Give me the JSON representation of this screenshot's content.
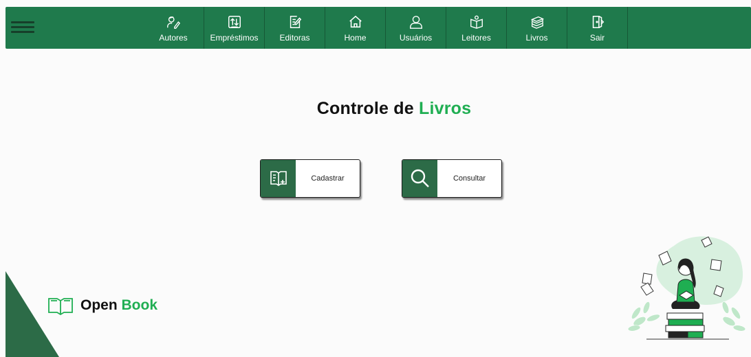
{
  "nav": {
    "menu_icon": "hamburger-icon",
    "items": [
      {
        "label": "Autores",
        "icon": "authors-icon"
      },
      {
        "label": "Empréstimos",
        "icon": "swap-icon"
      },
      {
        "label": "Editoras",
        "icon": "edit-document-icon"
      },
      {
        "label": "Home",
        "icon": "home-icon"
      },
      {
        "label": "Usuários",
        "icon": "user-icon"
      },
      {
        "label": "Leitores",
        "icon": "reader-icon"
      },
      {
        "label": "Livros",
        "icon": "books-icon"
      },
      {
        "label": "Sair",
        "icon": "exit-icon"
      }
    ]
  },
  "page": {
    "title_prefix": "Controle de",
    "title_accent": "Livros"
  },
  "actions": {
    "register_label": "Cadastrar",
    "search_label": "Consultar"
  },
  "footer": {
    "logo_prefix": "Open",
    "logo_accent": "Book"
  },
  "colors": {
    "nav_bg": "#1f7a4c",
    "accent": "#1fae52",
    "dark_green": "#2c6b47"
  }
}
